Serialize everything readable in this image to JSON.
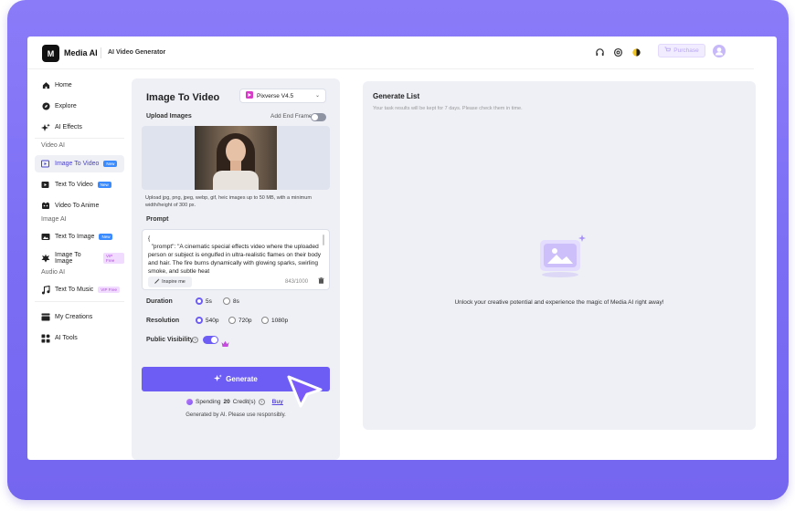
{
  "header": {
    "logo_text": "M",
    "brand": "Media AI",
    "product": "AI Video Generator",
    "purchase_label": "Purchase",
    "icons": [
      "headset-icon",
      "settings-icon",
      "theme-icon"
    ]
  },
  "sidebar": {
    "home": "Home",
    "explore": "Explore",
    "ai_effects": "AI Effects",
    "video_section": "Video AI",
    "image_to_video": "Image To Video",
    "image_to_video_badge": "New",
    "text_to_video": "Text To Video",
    "text_to_video_badge": "New",
    "video_to_anime": "Video To Anime",
    "image_section": "Image AI",
    "text_to_image": "Text To Image",
    "text_to_image_badge": "New",
    "image_to_image": "Image To Image",
    "image_to_image_badge": "VIP Free",
    "audio_section": "Audio AI",
    "text_to_music": "Text To Music",
    "text_to_music_badge": "VIP Free",
    "my_creations": "My Creations",
    "ai_tools": "AI Tools"
  },
  "form": {
    "title": "Image To Video",
    "model": "Pixverse V4.5",
    "upload_label": "Upload Images",
    "end_frame_label": "Add End Frame",
    "upload_hint": "Upload jpg, png, jpeg, webp, gif, heic images up to 50 MB, with a minimum width/height of 300 px.",
    "prompt_label": "Prompt",
    "prompt_text": "{\n  \"prompt\": \"A cinematic special effects video where the uploaded person or subject is engulfed in ultra-realistic flames on their body and hair. The fire burns dynamically with glowing sparks, swirling smoke, and subtle heat",
    "inspire_label": "Inspire me",
    "prompt_count": "843/1000",
    "duration_label": "Duration",
    "duration_options": [
      "5s",
      "8s"
    ],
    "resolution_label": "Resolution",
    "resolution_options": [
      "540p",
      "720p",
      "1080p"
    ],
    "visibility_label": "Public Visibility",
    "generate_label": "Generate",
    "spending_prefix": "Spending",
    "spending_amount": "20",
    "spending_suffix": "Credit(s)",
    "buy_label": "Buy",
    "disclaimer": "Generated by AI. Please use responsibly."
  },
  "generate_list": {
    "title": "Generate List",
    "subtitle": "Your task results will be kept for 7 days. Please check them in time.",
    "empty_message": "Unlock your creative potential and experience the magic of Media AI right away!"
  },
  "colors": {
    "accent": "#6d5df5",
    "frame": "#7b6cf4",
    "panel": "#eef0f6"
  }
}
